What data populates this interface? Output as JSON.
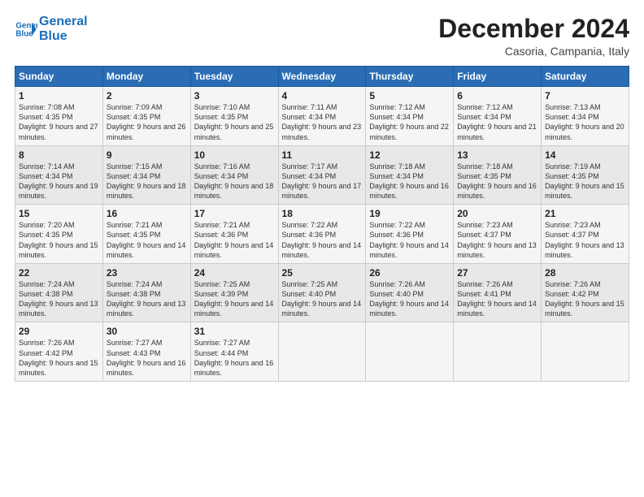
{
  "logo": {
    "line1": "General",
    "line2": "Blue"
  },
  "title": "December 2024",
  "subtitle": "Casoria, Campania, Italy",
  "header_days": [
    "Sunday",
    "Monday",
    "Tuesday",
    "Wednesday",
    "Thursday",
    "Friday",
    "Saturday"
  ],
  "weeks": [
    [
      {
        "day": "1",
        "sunrise": "Sunrise: 7:08 AM",
        "sunset": "Sunset: 4:35 PM",
        "daylight": "Daylight: 9 hours and 27 minutes."
      },
      {
        "day": "2",
        "sunrise": "Sunrise: 7:09 AM",
        "sunset": "Sunset: 4:35 PM",
        "daylight": "Daylight: 9 hours and 26 minutes."
      },
      {
        "day": "3",
        "sunrise": "Sunrise: 7:10 AM",
        "sunset": "Sunset: 4:35 PM",
        "daylight": "Daylight: 9 hours and 25 minutes."
      },
      {
        "day": "4",
        "sunrise": "Sunrise: 7:11 AM",
        "sunset": "Sunset: 4:34 PM",
        "daylight": "Daylight: 9 hours and 23 minutes."
      },
      {
        "day": "5",
        "sunrise": "Sunrise: 7:12 AM",
        "sunset": "Sunset: 4:34 PM",
        "daylight": "Daylight: 9 hours and 22 minutes."
      },
      {
        "day": "6",
        "sunrise": "Sunrise: 7:12 AM",
        "sunset": "Sunset: 4:34 PM",
        "daylight": "Daylight: 9 hours and 21 minutes."
      },
      {
        "day": "7",
        "sunrise": "Sunrise: 7:13 AM",
        "sunset": "Sunset: 4:34 PM",
        "daylight": "Daylight: 9 hours and 20 minutes."
      }
    ],
    [
      {
        "day": "8",
        "sunrise": "Sunrise: 7:14 AM",
        "sunset": "Sunset: 4:34 PM",
        "daylight": "Daylight: 9 hours and 19 minutes."
      },
      {
        "day": "9",
        "sunrise": "Sunrise: 7:15 AM",
        "sunset": "Sunset: 4:34 PM",
        "daylight": "Daylight: 9 hours and 18 minutes."
      },
      {
        "day": "10",
        "sunrise": "Sunrise: 7:16 AM",
        "sunset": "Sunset: 4:34 PM",
        "daylight": "Daylight: 9 hours and 18 minutes."
      },
      {
        "day": "11",
        "sunrise": "Sunrise: 7:17 AM",
        "sunset": "Sunset: 4:34 PM",
        "daylight": "Daylight: 9 hours and 17 minutes."
      },
      {
        "day": "12",
        "sunrise": "Sunrise: 7:18 AM",
        "sunset": "Sunset: 4:34 PM",
        "daylight": "Daylight: 9 hours and 16 minutes."
      },
      {
        "day": "13",
        "sunrise": "Sunrise: 7:18 AM",
        "sunset": "Sunset: 4:35 PM",
        "daylight": "Daylight: 9 hours and 16 minutes."
      },
      {
        "day": "14",
        "sunrise": "Sunrise: 7:19 AM",
        "sunset": "Sunset: 4:35 PM",
        "daylight": "Daylight: 9 hours and 15 minutes."
      }
    ],
    [
      {
        "day": "15",
        "sunrise": "Sunrise: 7:20 AM",
        "sunset": "Sunset: 4:35 PM",
        "daylight": "Daylight: 9 hours and 15 minutes."
      },
      {
        "day": "16",
        "sunrise": "Sunrise: 7:21 AM",
        "sunset": "Sunset: 4:35 PM",
        "daylight": "Daylight: 9 hours and 14 minutes."
      },
      {
        "day": "17",
        "sunrise": "Sunrise: 7:21 AM",
        "sunset": "Sunset: 4:36 PM",
        "daylight": "Daylight: 9 hours and 14 minutes."
      },
      {
        "day": "18",
        "sunrise": "Sunrise: 7:22 AM",
        "sunset": "Sunset: 4:36 PM",
        "daylight": "Daylight: 9 hours and 14 minutes."
      },
      {
        "day": "19",
        "sunrise": "Sunrise: 7:22 AM",
        "sunset": "Sunset: 4:36 PM",
        "daylight": "Daylight: 9 hours and 14 minutes."
      },
      {
        "day": "20",
        "sunrise": "Sunrise: 7:23 AM",
        "sunset": "Sunset: 4:37 PM",
        "daylight": "Daylight: 9 hours and 13 minutes."
      },
      {
        "day": "21",
        "sunrise": "Sunrise: 7:23 AM",
        "sunset": "Sunset: 4:37 PM",
        "daylight": "Daylight: 9 hours and 13 minutes."
      }
    ],
    [
      {
        "day": "22",
        "sunrise": "Sunrise: 7:24 AM",
        "sunset": "Sunset: 4:38 PM",
        "daylight": "Daylight: 9 hours and 13 minutes."
      },
      {
        "day": "23",
        "sunrise": "Sunrise: 7:24 AM",
        "sunset": "Sunset: 4:38 PM",
        "daylight": "Daylight: 9 hours and 13 minutes."
      },
      {
        "day": "24",
        "sunrise": "Sunrise: 7:25 AM",
        "sunset": "Sunset: 4:39 PM",
        "daylight": "Daylight: 9 hours and 14 minutes."
      },
      {
        "day": "25",
        "sunrise": "Sunrise: 7:25 AM",
        "sunset": "Sunset: 4:40 PM",
        "daylight": "Daylight: 9 hours and 14 minutes."
      },
      {
        "day": "26",
        "sunrise": "Sunrise: 7:26 AM",
        "sunset": "Sunset: 4:40 PM",
        "daylight": "Daylight: 9 hours and 14 minutes."
      },
      {
        "day": "27",
        "sunrise": "Sunrise: 7:26 AM",
        "sunset": "Sunset: 4:41 PM",
        "daylight": "Daylight: 9 hours and 14 minutes."
      },
      {
        "day": "28",
        "sunrise": "Sunrise: 7:26 AM",
        "sunset": "Sunset: 4:42 PM",
        "daylight": "Daylight: 9 hours and 15 minutes."
      }
    ],
    [
      {
        "day": "29",
        "sunrise": "Sunrise: 7:26 AM",
        "sunset": "Sunset: 4:42 PM",
        "daylight": "Daylight: 9 hours and 15 minutes."
      },
      {
        "day": "30",
        "sunrise": "Sunrise: 7:27 AM",
        "sunset": "Sunset: 4:43 PM",
        "daylight": "Daylight: 9 hours and 16 minutes."
      },
      {
        "day": "31",
        "sunrise": "Sunrise: 7:27 AM",
        "sunset": "Sunset: 4:44 PM",
        "daylight": "Daylight: 9 hours and 16 minutes."
      },
      null,
      null,
      null,
      null
    ]
  ]
}
